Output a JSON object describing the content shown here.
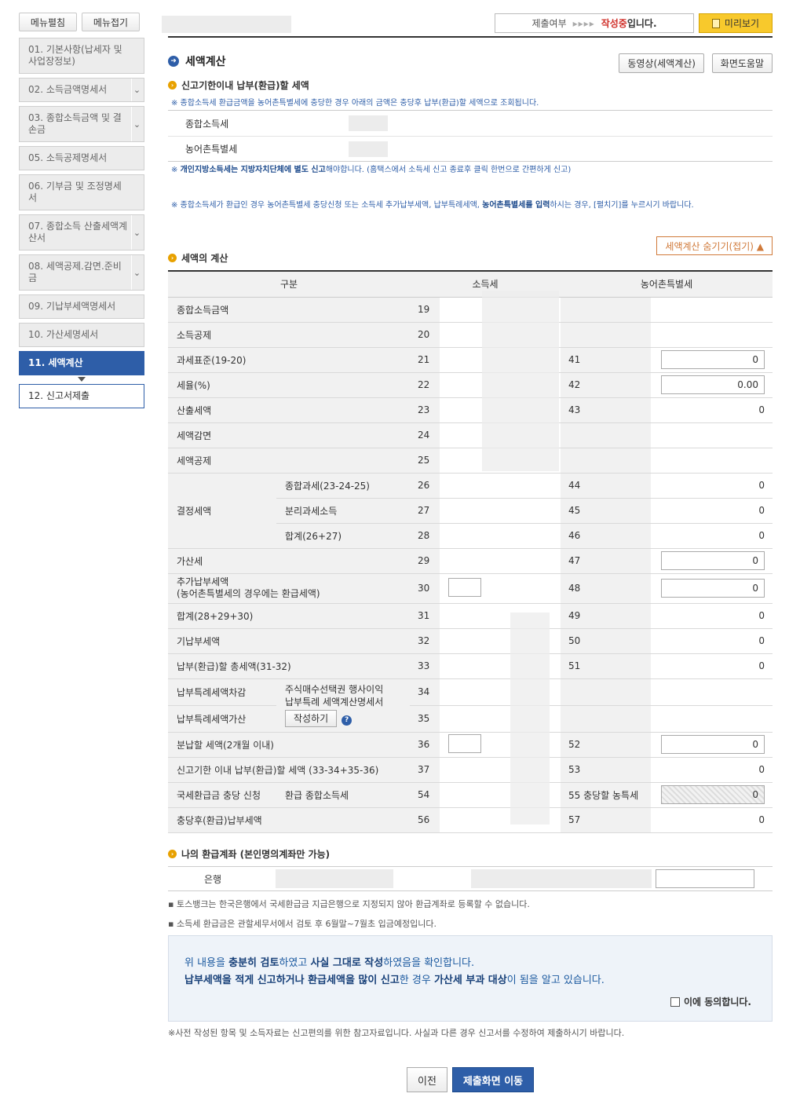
{
  "sidebar": {
    "expand_label": "메뉴펼침",
    "collapse_label": "메뉴접기",
    "items": [
      {
        "label": "01. 기본사항(납세자 및 사업장정보)",
        "chev": false
      },
      {
        "label": "02. 소득금액명세서",
        "chev": true
      },
      {
        "label": "03. 종합소득금액 및 결손금",
        "chev": true
      },
      {
        "label": "05. 소득공제명세서",
        "chev": false
      },
      {
        "label": "06. 기부금 및 조정명세서",
        "chev": false
      },
      {
        "label": "07. 종합소득 산출세액계산서",
        "chev": true
      },
      {
        "label": "08. 세액공제.감면.준비금",
        "chev": true
      },
      {
        "label": "09. 기납부세액명세서",
        "chev": false
      },
      {
        "label": "10. 가산세명세서",
        "chev": false
      }
    ],
    "active_label": "11. 세액계산",
    "next_label": "12. 신고서제출"
  },
  "topbar": {
    "status_prefix": "제출여부",
    "status_arrows": "▸▸▸▸",
    "status_state": "작성중",
    "status_suffix": "입니다.",
    "preview_label": "미리보기"
  },
  "page": {
    "title": "세액계산",
    "video_button": "동영상(세액계산)",
    "help_button": "화면도움말"
  },
  "deadline": {
    "section_title": "신고기한이내 납부(환급)할 세액",
    "note1": "※ 종합소득세 환급금액을 농어촌특별세에 충당한 경우 아래의 금액은 충당후 납부(환급)할 세액으로 조회됩니다.",
    "row1": "종합소득세",
    "row2": "농어촌특별세",
    "note2_a": "※ ",
    "note2_b": "개인지방소득세는 지방자치단체에 별도 신고",
    "note2_c": "해야합니다. (홈택스에서 소득세 신고 종료후 클릭 한번으로 간편하게 신고)",
    "note3_a": "※ 종합소득세가 환급인 경우 농어촌특별세 충당신청 또는 소득세 추가납부세액, 납부특례세액, ",
    "note3_b": "농어촌특별세를 입력",
    "note3_c": "하시는 경우, [펼치기]를 누르시기 바랍니다.",
    "hide_button": "세액계산 숨기기(접기) ▲"
  },
  "calc": {
    "section_title": "세액의 계산",
    "headers": [
      "구분",
      "소득세",
      "농어촌특별세"
    ],
    "rows": {
      "r19": "종합소득금액",
      "r20": "소득공제",
      "r21": "과세표준(19-20)",
      "r22": "세율(%)",
      "r23": "산출세액",
      "r24": "세액감면",
      "r25": "세액공제",
      "r_decision": "결정세액",
      "r26": "종합과세(23-24-25)",
      "r27": "분리과세소득",
      "r28": "합계(26+27)",
      "r29": "가산세",
      "r30_a": "추가납부세액",
      "r30_b": "(농어촌특별세의 경우에는 환급세액)",
      "r31": "합계(28+29+30)",
      "r32": "기납부세액",
      "r33": "납부(환급)할 총세액(31-32)",
      "r34": "납부특례세액차감",
      "r35": "납부특례세액가산",
      "special_a": "주식매수선택권 행사이익",
      "special_b": "납부특례 세액계산명세서",
      "write_button": "작성하기",
      "r36": "분납할 세액(2개월 이내)",
      "r37": "신고기한 이내 납부(환급)할 세액 (33-34+35-36)",
      "r54_label": "국세환급금 충당 신청",
      "r54_sub": "환급 종합소득세",
      "r56": "충당후(환급)납부세액"
    },
    "nums": {
      "n19": "19",
      "n20": "20",
      "n21": "21",
      "n22": "22",
      "n23": "23",
      "n24": "24",
      "n25": "25",
      "n26": "26",
      "n27": "27",
      "n28": "28",
      "n29": "29",
      "n30": "30",
      "n31": "31",
      "n32": "32",
      "n33": "33",
      "n34": "34",
      "n35": "35",
      "n36": "36",
      "n37": "37",
      "n54": "54",
      "n56": "56",
      "n41": "41",
      "n42": "42",
      "n43": "43",
      "n44": "44",
      "n45": "45",
      "n46": "46",
      "n47": "47",
      "n48": "48",
      "n49": "49",
      "n50": "50",
      "n51": "51",
      "n52": "52",
      "n53": "53",
      "n55": "55 충당할 농특세",
      "n57": "57"
    },
    "values": {
      "v41": "0",
      "v42": "0.00",
      "v43": "0",
      "v44": "0",
      "v45": "0",
      "v46": "0",
      "v47": "0",
      "v48": "0",
      "v49": "0",
      "v50": "0",
      "v51": "0",
      "v52": "0",
      "v53": "0",
      "v55": "0",
      "v57": "0"
    }
  },
  "refund": {
    "section_title": "나의 환급계좌 (본인명의계좌만 가능)",
    "bank_label": "은행",
    "note1": "토스뱅크는 한국은행에서 국세환급금 지급은행으로 지정되지 않아 환급계좌로 등록할 수 없습니다.",
    "note2": "소득세 환급금은 관할세무서에서 검토 후 6월말~7월초 입금예정입니다."
  },
  "confirm": {
    "l1_a": "위 내용을 ",
    "l1_b": "충분히 검토",
    "l1_c": "하였고 ",
    "l1_d": "사실 그대로 작성",
    "l1_e": "하였음을 확인합니다.",
    "l2_a": "납부세액을 적게 신고하거나 환급세액을 많이 신고",
    "l2_b": "한 경우 ",
    "l2_c": "가산세 부과 대상",
    "l2_d": "이 됨을 알고 있습니다.",
    "agree_label": "이에 동의합니다."
  },
  "footer": {
    "note": "※사전 작성된 항목 및 소득자료는 신고편의를 위한 참고자료입니다. 사실과 다른 경우 신고서를 수정하여 제출하시기 바랍니다.",
    "prev_button": "이전",
    "submit_button": "제출화면 이동"
  }
}
